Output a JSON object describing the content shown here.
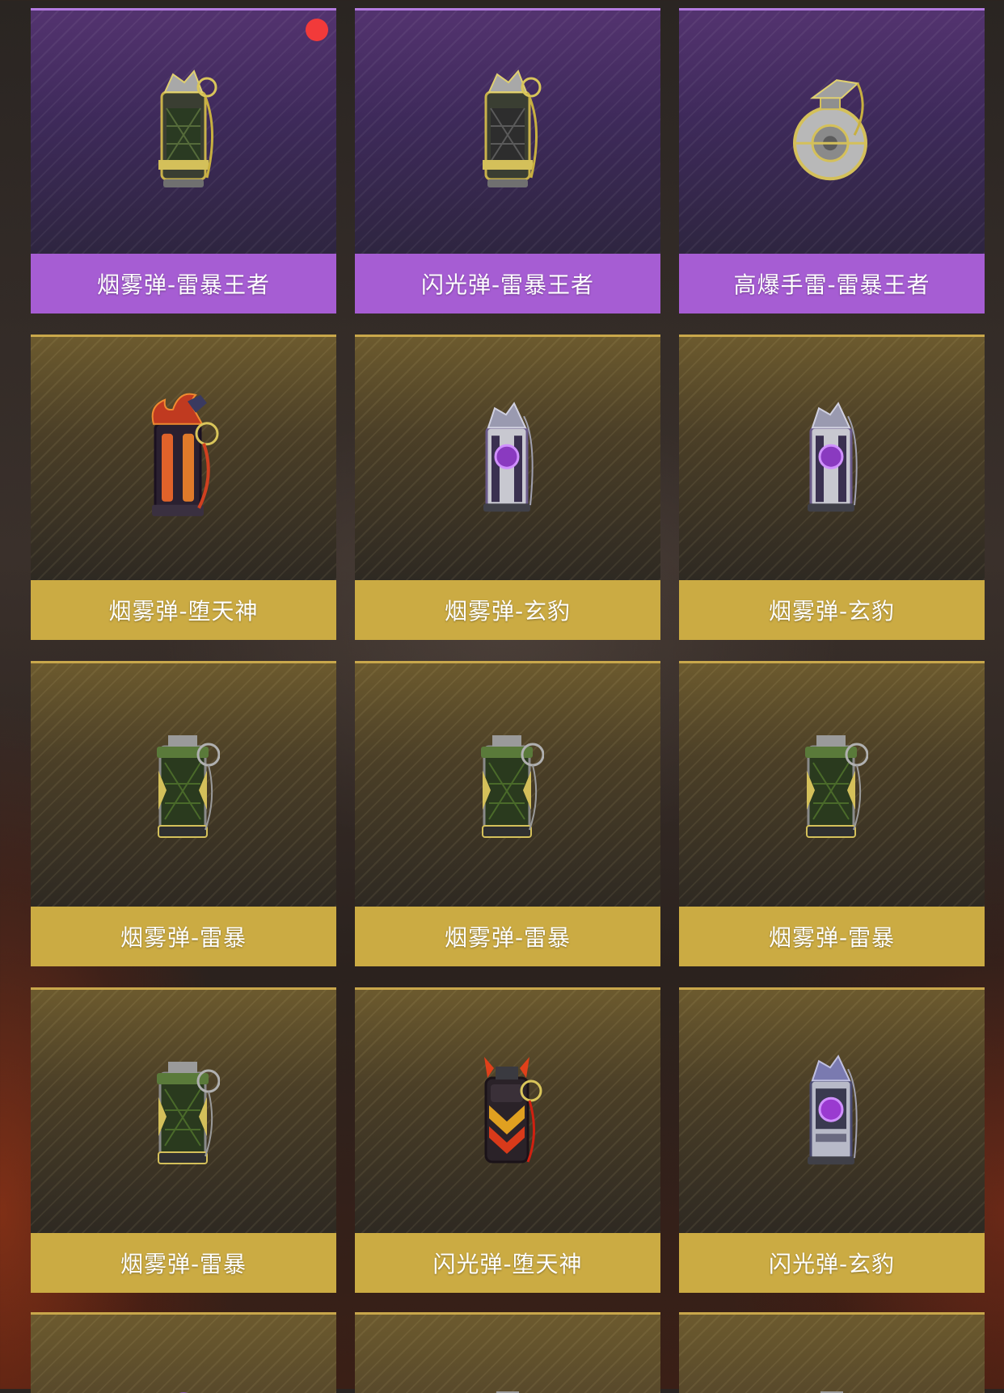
{
  "items": [
    {
      "label": "烟雾弹-雷暴王者",
      "rarity": "purple",
      "icon": "smoke-grenade-storm-king-icon",
      "badge": true
    },
    {
      "label": "闪光弹-雷暴王者",
      "rarity": "purple",
      "icon": "flash-grenade-storm-king-icon",
      "badge": false
    },
    {
      "label": "高爆手雷-雷暴王者",
      "rarity": "purple",
      "icon": "he-grenade-storm-king-icon",
      "badge": false
    },
    {
      "label": "烟雾弹-堕天神",
      "rarity": "gold",
      "icon": "smoke-grenade-fallen-god-icon",
      "badge": false
    },
    {
      "label": "烟雾弹-玄豹",
      "rarity": "gold",
      "icon": "smoke-grenade-black-panther-icon",
      "badge": false
    },
    {
      "label": "烟雾弹-玄豹",
      "rarity": "gold",
      "icon": "smoke-grenade-black-panther-icon",
      "badge": false
    },
    {
      "label": "烟雾弹-雷暴",
      "rarity": "gold",
      "icon": "smoke-grenade-storm-icon",
      "badge": false
    },
    {
      "label": "烟雾弹-雷暴",
      "rarity": "gold",
      "icon": "smoke-grenade-storm-icon",
      "badge": false
    },
    {
      "label": "烟雾弹-雷暴",
      "rarity": "gold",
      "icon": "smoke-grenade-storm-icon",
      "badge": false
    },
    {
      "label": "烟雾弹-雷暴",
      "rarity": "gold",
      "icon": "smoke-grenade-storm-icon",
      "badge": false
    },
    {
      "label": "闪光弹-堕天神",
      "rarity": "gold",
      "icon": "flash-grenade-fallen-god-icon",
      "badge": false
    },
    {
      "label": "闪光弹-玄豹",
      "rarity": "gold",
      "icon": "flash-grenade-black-panther-icon",
      "badge": false
    }
  ],
  "colors": {
    "purple_label": "#a65dd3",
    "gold_label": "#cbab43",
    "badge": "#f23a3a"
  }
}
